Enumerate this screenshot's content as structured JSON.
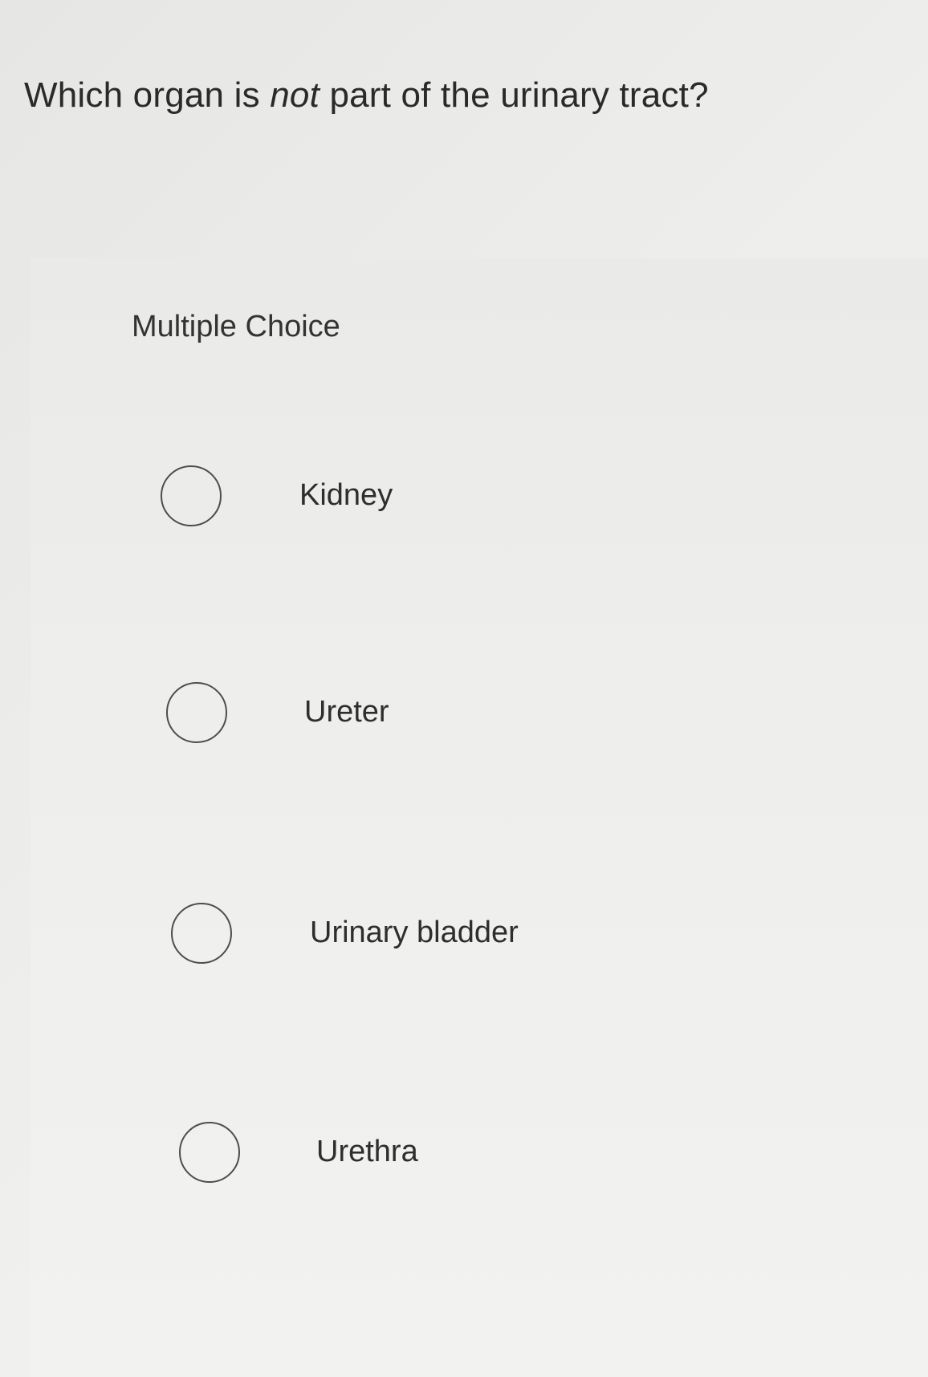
{
  "question": {
    "text_before": "Which organ is ",
    "text_emphasis": "not",
    "text_after": " part of the urinary tract?"
  },
  "question_type": "Multiple Choice",
  "options": [
    {
      "label": "Kidney",
      "selected": false
    },
    {
      "label": "Ureter",
      "selected": false
    },
    {
      "label": "Urinary bladder",
      "selected": false
    },
    {
      "label": "Urethra",
      "selected": false
    }
  ]
}
